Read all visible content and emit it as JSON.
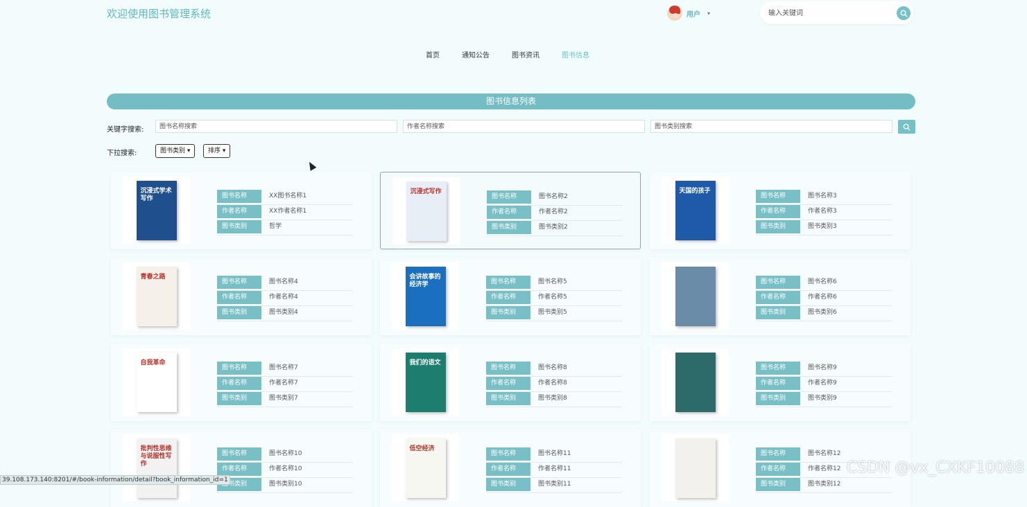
{
  "header": {
    "site_title": "欢迎使用图书管理系统",
    "user_label": "用户",
    "search_placeholder": "输入关键词"
  },
  "nav": {
    "items": [
      "首页",
      "通知公告",
      "图书资讯",
      "图书信息"
    ],
    "active": "图书信息"
  },
  "list": {
    "title": "图书信息列表",
    "keyword_label": "关键字搜索:",
    "name_placeholder": "图书名称搜索",
    "author_placeholder": "作者名称搜索",
    "category_placeholder": "图书类别搜索",
    "dropdown_label": "下拉搜索:",
    "category_dropdown": "图书类别",
    "sort_dropdown": "排序"
  },
  "field_labels": {
    "name": "图书名称",
    "author": "作者名称",
    "category": "图书类别"
  },
  "books": [
    {
      "name": "XX图书名称1",
      "author": "XX作者名称1",
      "category": "哲学",
      "cover_title": "沉浸式学术写作",
      "cover_color": "#1f4f8c"
    },
    {
      "name": "图书名称2",
      "author": "作者名称2",
      "category": "图书类别2",
      "cover_title": "沉浸式写作",
      "cover_color": "#e8eef5"
    },
    {
      "name": "图书名称3",
      "author": "作者名称3",
      "category": "图书类别3",
      "cover_title": "天国的孩子",
      "cover_color": "#1e5aa8"
    },
    {
      "name": "图书名称4",
      "author": "作者名称4",
      "category": "图书类别4",
      "cover_title": "青春之路",
      "cover_color": "#f5f0ea"
    },
    {
      "name": "图书名称5",
      "author": "作者名称5",
      "category": "图书类别5",
      "cover_title": "会讲故事的经济学",
      "cover_color": "#1b6fc0"
    },
    {
      "name": "图书名称6",
      "author": "作者名称6",
      "category": "图书类别6",
      "cover_title": "",
      "cover_color": "#6a8ca8"
    },
    {
      "name": "图书名称7",
      "author": "作者名称7",
      "category": "图书类别7",
      "cover_title": "自我革命",
      "cover_color": "#ffffff"
    },
    {
      "name": "图书名称8",
      "author": "作者名称8",
      "category": "图书类别8",
      "cover_title": "我们的语文",
      "cover_color": "#1d7d6e"
    },
    {
      "name": "图书名称9",
      "author": "作者名称9",
      "category": "图书类别9",
      "cover_title": "",
      "cover_color": "#2d6b6b"
    },
    {
      "name": "图书名称10",
      "author": "作者名称10",
      "category": "图书类别10",
      "cover_title": "批判性思维与说服性写作",
      "cover_color": "#f2f2f2"
    },
    {
      "name": "图书名称11",
      "author": "作者名称11",
      "category": "图书类别11",
      "cover_title": "低空经济",
      "cover_color": "#f7f7f2"
    },
    {
      "name": "图书名称12",
      "author": "作者名称12",
      "category": "图书类别12",
      "cover_title": "",
      "cover_color": "#f3f1ee"
    }
  ],
  "status_bar_url": "39.108.173.140:8201/#/book-information/detail?book_information_id=1",
  "watermark": "CSDN @vx_CXKF10088"
}
